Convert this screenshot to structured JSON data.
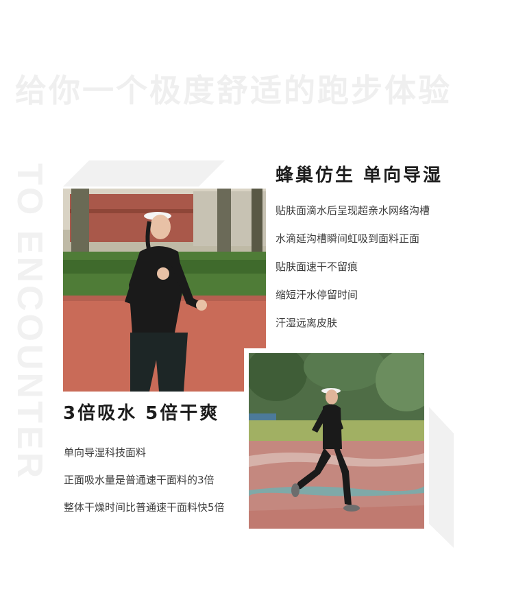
{
  "background_title": "给你一个极度舒适的跑步体验",
  "vertical_text": "TO ENCOUNTER",
  "section_1": {
    "heading": "蜂巢仿生 单向导湿",
    "items": [
      "贴肤面滴水后呈现超亲水网络沟槽",
      "水滴延沟槽瞬间虹吸到面料正面",
      "贴肤面速干不留痕",
      "缩短汗水停留时间",
      "汗湿远离皮肤"
    ]
  },
  "section_2": {
    "heading": "3倍吸水 5倍干爽",
    "items": [
      "单向导湿科技面料",
      "正面吸水量是普通速干面料的3倍",
      "整体干燥时间比普通速干面料快5倍"
    ]
  },
  "colors": {
    "heading": "#1c1c1c",
    "body_text": "#3c3c3c",
    "decor_gray": "#f1f1f1",
    "track_red": "#c96b58",
    "outfit_black": "#1a1a1a"
  }
}
